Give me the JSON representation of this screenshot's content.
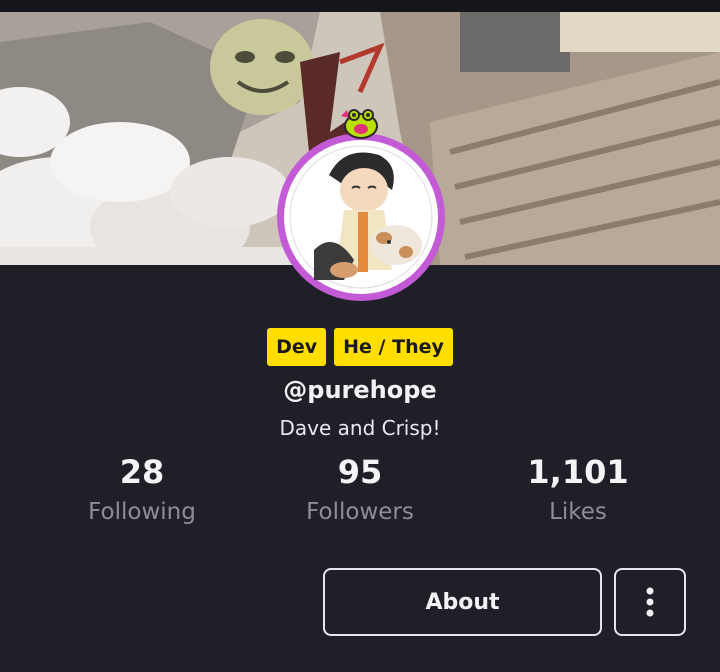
{
  "profile": {
    "tags": [
      "Dev",
      "He / They"
    ],
    "handle": "@purehope",
    "bio": "Dave and Crisp!"
  },
  "stats": {
    "following": {
      "value": "28",
      "label": "Following"
    },
    "followers": {
      "value": "95",
      "label": "Followers"
    },
    "likes": {
      "value": "1,101",
      "label": "Likes"
    }
  },
  "actions": {
    "about_label": "About",
    "more_icon": "vertical-ellipsis-icon"
  },
  "colors": {
    "background": "#1f1f28",
    "tag_bg": "#ffde00",
    "avatar_ring": "#c45bd6",
    "muted_text": "#8d8d99"
  }
}
